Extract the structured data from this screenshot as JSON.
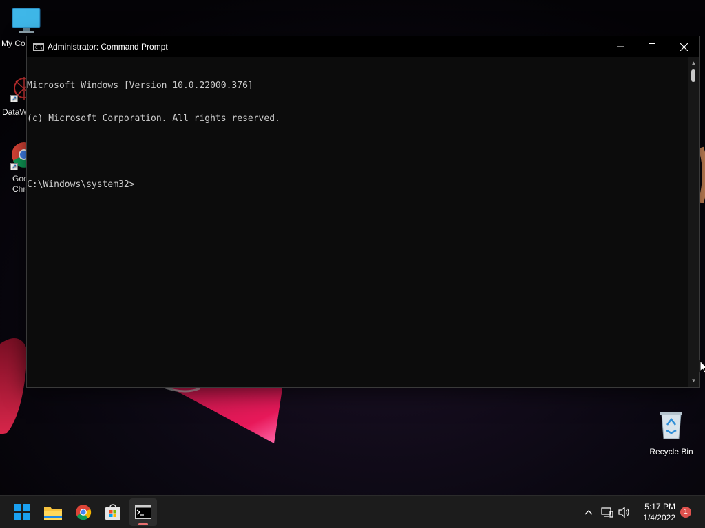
{
  "desktop": {
    "icons": [
      {
        "name": "my-computer",
        "label": "My Co"
      },
      {
        "name": "datawarrior",
        "label": "DataW"
      },
      {
        "name": "google-chrome",
        "label": "Goo\nChro"
      },
      {
        "name": "recycle-bin",
        "label": "Recycle Bin"
      }
    ]
  },
  "window": {
    "title": "Administrator: Command Prompt",
    "title_icon_text": "C:\\_",
    "console_lines": [
      "Microsoft Windows [Version 10.0.22000.376]",
      "(c) Microsoft Corporation. All rights reserved.",
      "",
      "C:\\Windows\\system32>"
    ],
    "controls": {
      "minimize": "minimize-icon",
      "maximize": "maximize-icon",
      "close": "close-icon"
    }
  },
  "taskbar": {
    "pinned": [
      "start-icon",
      "file-explorer-icon",
      "chrome-icon",
      "store-icon",
      "terminal-icon"
    ],
    "active": "terminal-icon",
    "tray": [
      "chevron-up-icon",
      "network-icon",
      "volume-icon"
    ],
    "time": "5:17 PM",
    "date": "1/4/2022",
    "notification_count": "1"
  },
  "colors": {
    "console_bg": "#0c0c0c",
    "console_text": "#cccccc",
    "taskbar_bg": "#1c1c1c",
    "accent_red": "#e0524e"
  }
}
